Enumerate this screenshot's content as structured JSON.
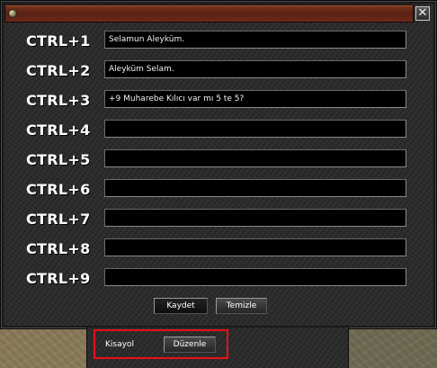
{
  "window": {
    "close_label": "✕"
  },
  "shortcuts": [
    {
      "key": "CTRL+1",
      "value": "Selamun Aleyküm."
    },
    {
      "key": "CTRL+2",
      "value": "Aleyküm Selam."
    },
    {
      "key": "CTRL+3",
      "value": "+9 Muharebe Kılıcı var mı 5 te 5?"
    },
    {
      "key": "CTRL+4",
      "value": ""
    },
    {
      "key": "CTRL+5",
      "value": ""
    },
    {
      "key": "CTRL+6",
      "value": ""
    },
    {
      "key": "CTRL+7",
      "value": ""
    },
    {
      "key": "CTRL+8",
      "value": ""
    },
    {
      "key": "CTRL+9",
      "value": ""
    }
  ],
  "buttons": {
    "save": "Kaydet",
    "clear": "Temizle"
  },
  "bottom_panel": {
    "label": "Kisayol",
    "edit_button": "Düzenle"
  },
  "colors": {
    "highlight": "#e8101a",
    "titlebar": "#6a2a18"
  }
}
